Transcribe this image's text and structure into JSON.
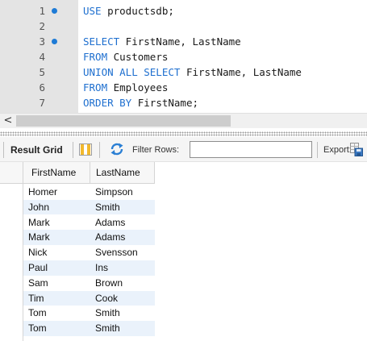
{
  "editor": {
    "lines": [
      {
        "number": "1",
        "marker": true,
        "keyword": "USE",
        "rest": " productsdb;"
      },
      {
        "number": "2",
        "marker": false,
        "keyword": "",
        "rest": ""
      },
      {
        "number": "3",
        "marker": true,
        "keyword": "SELECT",
        "rest": " FirstName, LastName"
      },
      {
        "number": "4",
        "marker": false,
        "keyword": "FROM",
        "rest": " Customers"
      },
      {
        "number": "5",
        "marker": false,
        "keyword": "UNION ALL SELECT",
        "rest": " FirstName, LastName"
      },
      {
        "number": "6",
        "marker": false,
        "keyword": "FROM",
        "rest": " Employees"
      },
      {
        "number": "7",
        "marker": false,
        "keyword": "ORDER BY",
        "rest": " FirstName;"
      }
    ]
  },
  "scrollbar": {
    "left_arrow": "<"
  },
  "toolbar": {
    "result_grid_label": "Result Grid",
    "filter_label": "Filter Rows:",
    "filter_value": "",
    "export_label": "Export:"
  },
  "grid": {
    "columns": [
      "FirstName",
      "LastName"
    ],
    "rows": [
      [
        "Homer",
        "Simpson"
      ],
      [
        "John",
        "Smith"
      ],
      [
        "Mark",
        "Adams"
      ],
      [
        "Mark",
        "Adams"
      ],
      [
        "Nick",
        "Svensson"
      ],
      [
        "Paul",
        "Ins"
      ],
      [
        "Sam",
        "Brown"
      ],
      [
        "Tim",
        "Cook"
      ],
      [
        "Tom",
        "Smith"
      ],
      [
        "Tom",
        "Smith"
      ]
    ]
  },
  "colors": {
    "keyword": "#1e6fcf",
    "marker": "#1e7bd6",
    "gutter": "#e4e4e4",
    "alt_row": "#eaf2fb"
  }
}
